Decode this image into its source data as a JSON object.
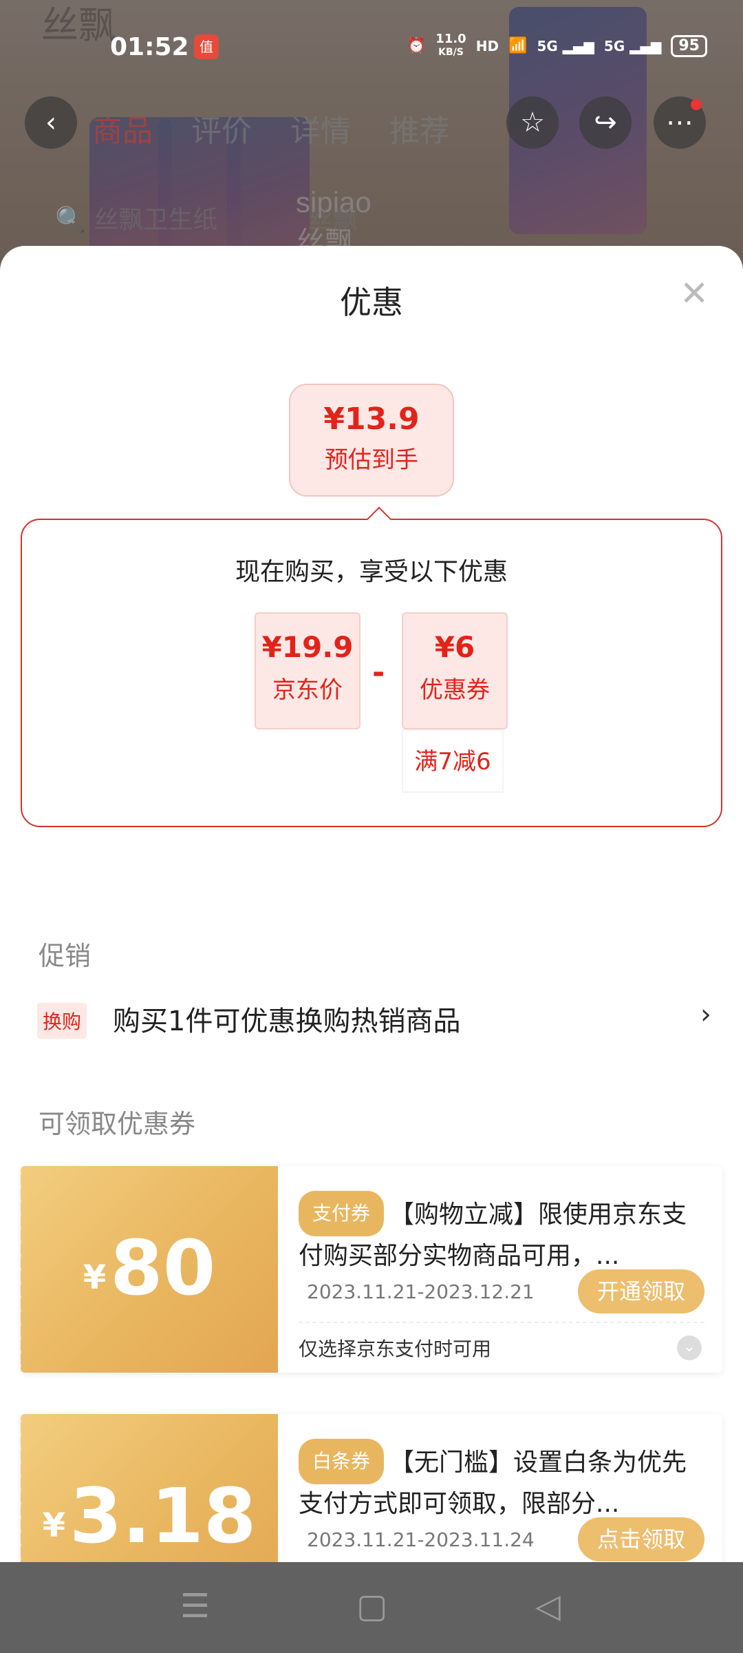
{
  "background": {
    "brand_logo": "丝飘",
    "product_brand": "sipiao",
    "product_name": "丝飘"
  },
  "status_bar": {
    "time": "01:52",
    "app_icon_text": "值",
    "net_speed": "11.0",
    "net_unit": "KB/S",
    "hd": "HD",
    "sig1": "5G",
    "sig2": "5G",
    "battery": "95"
  },
  "top_nav": {
    "tabs": [
      "商品",
      "评价",
      "详情",
      "推荐"
    ],
    "active_tab": "商品",
    "search_left": "丝飘卫生纸",
    "search_right": "丝飘"
  },
  "sheet": {
    "title": "优惠",
    "close_icon": "close-icon"
  },
  "estimate": {
    "price": "¥13.9",
    "label": "预估到手"
  },
  "calc": {
    "heading": "现在购买，享受以下优惠",
    "base_price": "¥19.9",
    "base_label": "京东价",
    "minus": "-",
    "coupon_value": "¥6",
    "coupon_label": "优惠券",
    "coupon_condition": "满7减6"
  },
  "promotion": {
    "section_title": "促销",
    "tag": "换购",
    "text": "购买1件可优惠换购热销商品",
    "arrow": "›"
  },
  "coupons_section": {
    "title": "可领取优惠券",
    "items": [
      {
        "currency": "¥",
        "amount": "80",
        "tag": "支付券",
        "desc": "【购物立减】限使用京东支付购买部分实物商品可用，...",
        "date": "2023.11.21-2023.12.21",
        "button": "开通领取",
        "note": "仅选择京东支付时可用"
      },
      {
        "currency": "¥",
        "amount": "3.18",
        "tag": "白条券",
        "desc": "【无门槛】设置白条为优先支付方式即可领取，限部分...",
        "date": "2023.11.21-2023.11.24",
        "button": "点击领取"
      }
    ]
  },
  "nav_bar": {
    "menu": "☰",
    "home": "▢",
    "back": "◁"
  }
}
